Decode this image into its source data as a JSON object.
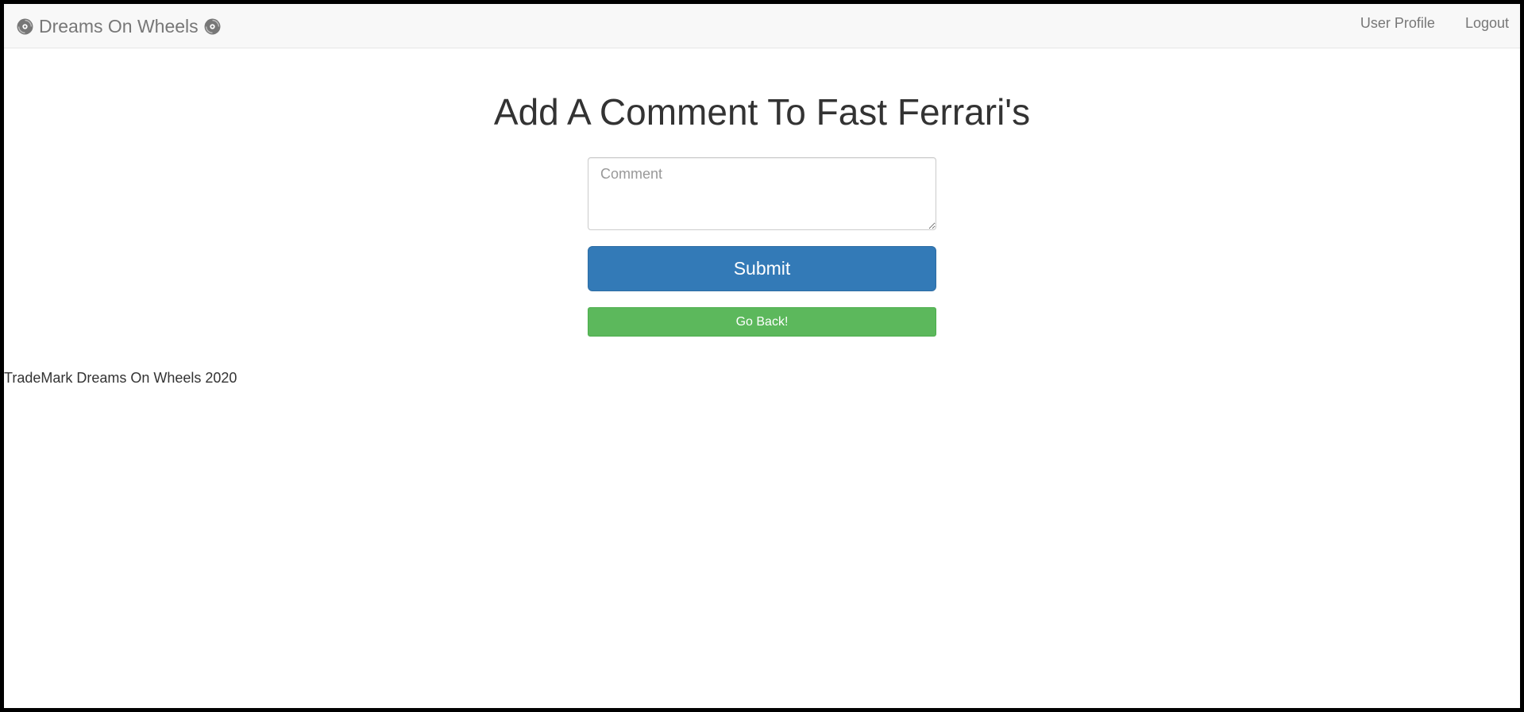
{
  "app": {
    "brand_name": "Dreams On Wheels",
    "brand_icon": "disc-icon"
  },
  "nav": {
    "user_profile_label": "User Profile",
    "logout_label": "Logout"
  },
  "main": {
    "title": "Add A Comment To Fast Ferrari's",
    "comment_placeholder": "Comment",
    "comment_value": "",
    "submit_label": "Submit",
    "back_label": "Go Back!"
  },
  "footer": {
    "text": "TradeMark Dreams On Wheels 2020"
  },
  "colors": {
    "primary": "#337ab7",
    "success": "#5cb85c",
    "navbar_bg": "#f8f8f8",
    "nav_text": "#777777"
  }
}
